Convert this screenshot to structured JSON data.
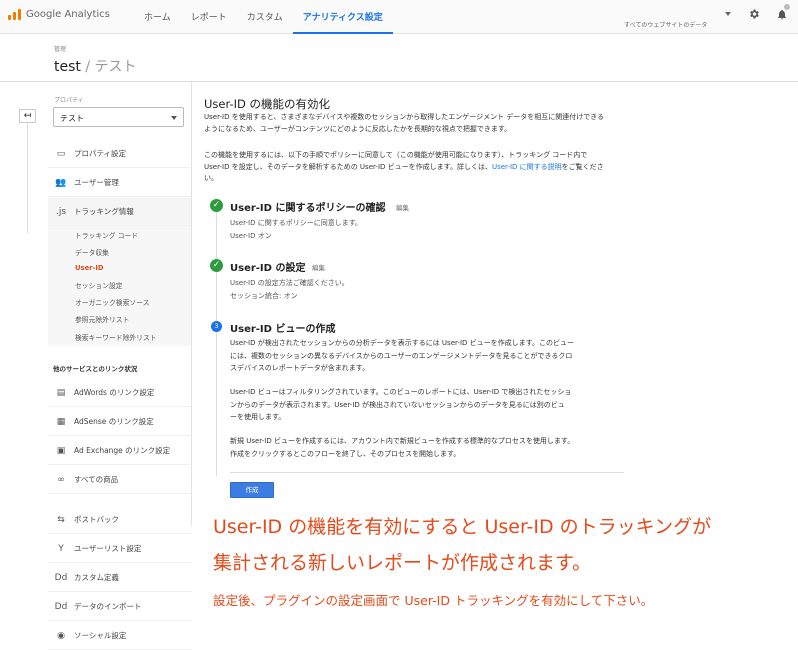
{
  "app": {
    "logo_text": "Google Analytics"
  },
  "nav": {
    "items": [
      {
        "label": "ホーム"
      },
      {
        "label": "レポート"
      },
      {
        "label": "カスタム"
      },
      {
        "label": "アナリティクス設定"
      }
    ],
    "active_index": 3
  },
  "account": {
    "label": "すべてのウェブサイトのデータ"
  },
  "colors": {
    "accent": "#1a73e8",
    "success": "#2e9b3f",
    "annotation": "#e54a1a",
    "logo": "#f57c00"
  },
  "header": {
    "crumb": "管理",
    "title": "test",
    "subtitle": "/ テスト"
  },
  "sidebar": {
    "back_icon": "↤",
    "property_label": "プロパティ",
    "property_value": "テスト",
    "items": [
      {
        "icon": "▭",
        "label": "プロパティ設定"
      },
      {
        "icon": "👥",
        "label": "ユーザー管理"
      },
      {
        "icon": ".js",
        "label": "トラッキング情報"
      }
    ],
    "subitems": [
      {
        "label": "トラッキング コード"
      },
      {
        "label": "データ収集"
      },
      {
        "label": "User-ID"
      },
      {
        "label": "セッション設定"
      },
      {
        "label": "オーガニック検索ソース"
      },
      {
        "label": "参照元除外リスト"
      },
      {
        "label": "検索キーワード除外リスト"
      }
    ],
    "section_label": "他のサービスとのリンク状況",
    "link_items": [
      {
        "icon": "▤",
        "label": "AdWords のリンク設定"
      },
      {
        "icon": "▦",
        "label": "AdSense のリンク設定"
      },
      {
        "icon": "▣",
        "label": "Ad Exchange のリンク設定"
      },
      {
        "icon": "∞",
        "label": "すべての商品"
      }
    ],
    "bottom_items": [
      {
        "icon": "⇆",
        "label": "ポストバック"
      },
      {
        "icon": "Y",
        "label": "ユーザーリスト設定"
      },
      {
        "icon": "Dd",
        "label": "カスタム定義"
      },
      {
        "icon": "Dd",
        "label": "データのインポート"
      },
      {
        "icon": "◉",
        "label": "ソーシャル設定"
      }
    ]
  },
  "main": {
    "title": "User-ID の機能の有効化",
    "intro_line1": "User-ID を使用すると、さまざまなデバイスや複数のセッションから取得したエンゲージメント データを相互に関連付けできる",
    "intro_line2": "ようになるため、ユーザーがコンテンツにどのように反応したかを長期的な視点で把握できます。",
    "how_line1": "この機能を使用するには、以下の手順でポリシーに同意して（この機能が使用可能になります）、トラッキング コード内で",
    "how_line2": "User-ID を設定し、そのデータを解析するための User-ID ビューを作成します。詳しくは、",
    "how_link": "User-ID に関する説明",
    "how_tail": "をご覧くださ",
    "how_line3": "い。",
    "steps": [
      {
        "title": "User-ID に関するポリシーの確認",
        "edit": "編集",
        "desc1": "User-ID に関するポリシーに同意します。",
        "desc2": "User-ID オン"
      },
      {
        "title": "User-ID の設定",
        "edit": "編集",
        "desc1": "User-ID の設定方法ご確認ください。",
        "desc2": "セッション統合: オン"
      },
      {
        "number": "3",
        "title": "User-ID ビューの作成"
      }
    ],
    "step3_p1": [
      "User-ID が検出されたセッションからの分析データを表示するには User-ID ビューを作成します。このビュー",
      "には、複数のセッションの異なるデバイスからのユーザーのエンゲージメントデータを見ることができるクロ",
      "スデバイスのレポートデータが含まれます。"
    ],
    "step3_p2": [
      "User-ID ビューはフィルタリングされています。このビューのレポートには、User-ID で検出されたセッショ",
      "ンからのデータが表示されます。User-ID が検出されていないセッションからのデータを見るには別のビュ",
      "ーを使用します。"
    ],
    "step3_p3": [
      "新規 User-ID ビューを作成するには、アカウント内で新規ビューを作成する標準的なプロセスを使用します。",
      "作成をクリックするとこのフローを終了し、そのプロセスを開始します。"
    ],
    "create_button": "作成"
  },
  "annotation": {
    "line1": "User-ID の機能を有効にすると User-ID のトラッキングが",
    "line2": "集計される新しいレポートが作成されます。",
    "line3": "設定後、プラグインの設定画面で User-ID トラッキングを有効にして下さい。"
  }
}
